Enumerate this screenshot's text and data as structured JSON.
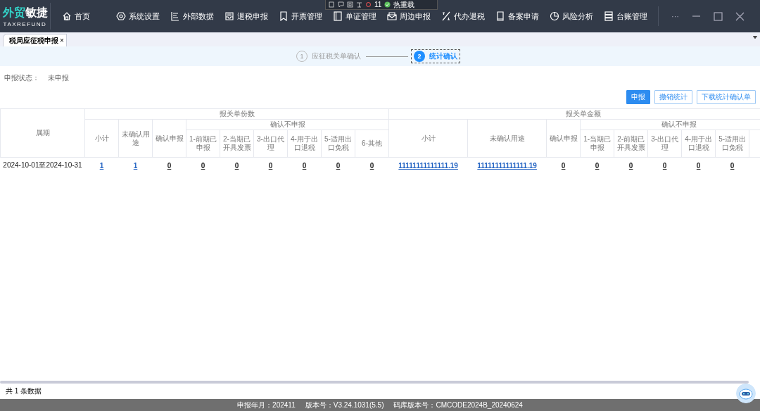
{
  "app": {
    "logo_part1": "外贸",
    "logo_part2": "敏捷",
    "subtitle": "TAXREFUND"
  },
  "nav": [
    {
      "label": "首页",
      "kind": "home"
    },
    {
      "label": "系统设置",
      "kind": "gear"
    },
    {
      "label": "外部数据",
      "kind": "list"
    },
    {
      "label": "退税申报",
      "kind": "inbox"
    },
    {
      "label": "开票管理",
      "kind": "bookmark"
    },
    {
      "label": "单证管理",
      "kind": "doc"
    },
    {
      "label": "周边申报",
      "kind": "mail"
    },
    {
      "label": "代办退税",
      "kind": "percent"
    },
    {
      "label": "备案申请",
      "kind": "book"
    },
    {
      "label": "风险分析",
      "kind": "pie"
    },
    {
      "label": "台账管理",
      "kind": "stack"
    }
  ],
  "window_controls": {
    "more": "···"
  },
  "screen_toolbar": {
    "count": "11",
    "label": "热重载"
  },
  "tabs": [
    {
      "label": "税局应征税申报",
      "selected": true,
      "close": "×"
    }
  ],
  "steps": [
    {
      "number": "1",
      "label": "应征税关单确认",
      "selected": false
    },
    {
      "number": "2",
      "label": "统计确认",
      "selected": true
    }
  ],
  "status": {
    "label": "申报状态：",
    "value": "未申报"
  },
  "buttons": [
    {
      "label": "申报",
      "kind": "primary"
    },
    {
      "label": "撤销统计",
      "kind": "outline"
    },
    {
      "label": "下载统计确认单",
      "kind": "outline"
    }
  ],
  "table": {
    "period_header": "属期",
    "groups": [
      {
        "title": "报关单份数",
        "columns": [
          "小计",
          "未确认用途",
          "确认申报"
        ],
        "subgroup": {
          "title": "确认不申报",
          "columns": [
            "1-前期已申报",
            "2-当期已开具发票",
            "3-出口代理",
            "4-用于出口退税",
            "5-适用出口免税",
            "6-其他"
          ]
        }
      },
      {
        "title": "报关单金额",
        "columns": [
          "小计",
          "未确认用途",
          "确认申报"
        ],
        "subgroup": {
          "title": "确认不申报",
          "columns": [
            "1-当期已申报",
            "2-前期已开具发票",
            "3-出口代理",
            "4-用于出口退税",
            "5-适用出口免税"
          ]
        }
      }
    ],
    "rows": [
      {
        "cells": [
          {
            "text": "2024-10-01至2024-10-31",
            "kind": "plain"
          },
          {
            "text": "1",
            "kind": "link"
          },
          {
            "text": "1",
            "kind": "link"
          },
          {
            "text": "0",
            "kind": "value"
          },
          {
            "text": "0",
            "kind": "value"
          },
          {
            "text": "0",
            "kind": "value"
          },
          {
            "text": "0",
            "kind": "value"
          },
          {
            "text": "0",
            "kind": "value"
          },
          {
            "text": "0",
            "kind": "value"
          },
          {
            "text": "0",
            "kind": "value"
          },
          {
            "text": "11111111111111.19",
            "kind": "link"
          },
          {
            "text": "11111111111111.19",
            "kind": "link"
          },
          {
            "text": "0",
            "kind": "value"
          },
          {
            "text": "0",
            "kind": "value"
          },
          {
            "text": "0",
            "kind": "value"
          },
          {
            "text": "0",
            "kind": "value"
          },
          {
            "text": "0",
            "kind": "value"
          },
          {
            "text": "0",
            "kind": "value"
          }
        ]
      }
    ]
  },
  "record_count": "共 1 条数据",
  "status_bar": [
    {
      "label": "申报年月：",
      "value": "202411"
    },
    {
      "label": "版本号：",
      "value": "V3.24.1031(5.5)"
    },
    {
      "label": "码库版本号：",
      "value": "CMCODE2024B_20240624"
    }
  ]
}
